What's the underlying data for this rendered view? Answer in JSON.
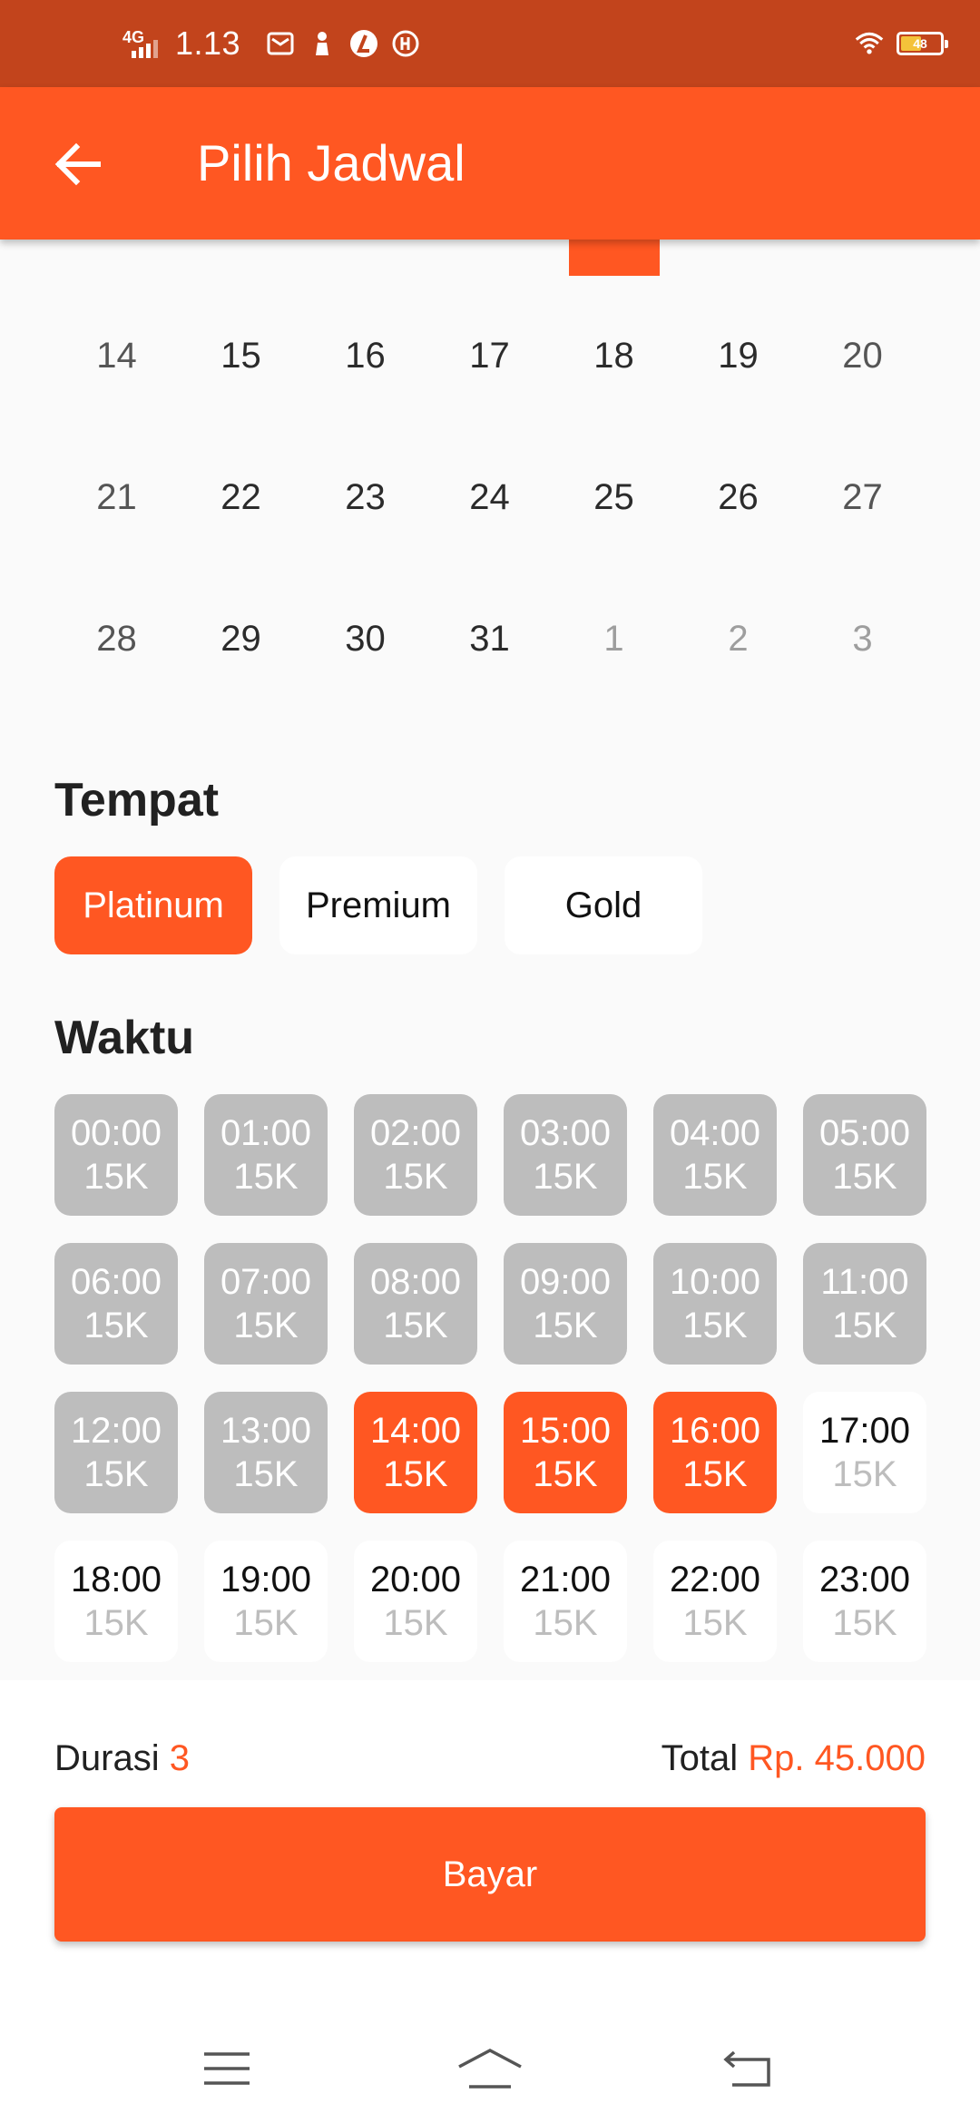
{
  "status_bar": {
    "network": "4G",
    "time": "1.13",
    "battery_level": "48",
    "icons": [
      "mail-icon",
      "person-icon",
      "app-l-icon",
      "app-circle-icon",
      "wifi-icon",
      "battery-icon"
    ]
  },
  "app_bar": {
    "title": "Pilih Jadwal",
    "back_icon": "arrow-left-icon"
  },
  "calendar": {
    "weeks": [
      [
        {
          "day": "14",
          "muted": false
        },
        {
          "day": "15",
          "muted": false
        },
        {
          "day": "16",
          "muted": false
        },
        {
          "day": "17",
          "muted": false
        },
        {
          "day": "18",
          "muted": false
        },
        {
          "day": "19",
          "muted": false
        },
        {
          "day": "20",
          "muted": false
        }
      ],
      [
        {
          "day": "21",
          "muted": false
        },
        {
          "day": "22",
          "muted": false
        },
        {
          "day": "23",
          "muted": false
        },
        {
          "day": "24",
          "muted": false
        },
        {
          "day": "25",
          "muted": false
        },
        {
          "day": "26",
          "muted": false
        },
        {
          "day": "27",
          "muted": false
        }
      ],
      [
        {
          "day": "28",
          "muted": false
        },
        {
          "day": "29",
          "muted": false
        },
        {
          "day": "30",
          "muted": false
        },
        {
          "day": "31",
          "muted": false
        },
        {
          "day": "1",
          "muted": true
        },
        {
          "day": "2",
          "muted": true
        },
        {
          "day": "3",
          "muted": true
        }
      ]
    ]
  },
  "venue": {
    "title": "Tempat",
    "options": [
      {
        "label": "Platinum",
        "selected": true
      },
      {
        "label": "Premium",
        "selected": false
      },
      {
        "label": "Gold",
        "selected": false
      }
    ]
  },
  "time_slots": {
    "title": "Waktu",
    "slots": [
      {
        "time": "00:00",
        "price": "15K",
        "state": "unavailable"
      },
      {
        "time": "01:00",
        "price": "15K",
        "state": "unavailable"
      },
      {
        "time": "02:00",
        "price": "15K",
        "state": "unavailable"
      },
      {
        "time": "03:00",
        "price": "15K",
        "state": "unavailable"
      },
      {
        "time": "04:00",
        "price": "15K",
        "state": "unavailable"
      },
      {
        "time": "05:00",
        "price": "15K",
        "state": "unavailable"
      },
      {
        "time": "06:00",
        "price": "15K",
        "state": "unavailable"
      },
      {
        "time": "07:00",
        "price": "15K",
        "state": "unavailable"
      },
      {
        "time": "08:00",
        "price": "15K",
        "state": "unavailable"
      },
      {
        "time": "09:00",
        "price": "15K",
        "state": "unavailable"
      },
      {
        "time": "10:00",
        "price": "15K",
        "state": "unavailable"
      },
      {
        "time": "11:00",
        "price": "15K",
        "state": "unavailable"
      },
      {
        "time": "12:00",
        "price": "15K",
        "state": "unavailable"
      },
      {
        "time": "13:00",
        "price": "15K",
        "state": "unavailable"
      },
      {
        "time": "14:00",
        "price": "15K",
        "state": "selected"
      },
      {
        "time": "15:00",
        "price": "15K",
        "state": "selected"
      },
      {
        "time": "16:00",
        "price": "15K",
        "state": "selected"
      },
      {
        "time": "17:00",
        "price": "15K",
        "state": "available"
      },
      {
        "time": "18:00",
        "price": "15K",
        "state": "available"
      },
      {
        "time": "19:00",
        "price": "15K",
        "state": "available"
      },
      {
        "time": "20:00",
        "price": "15K",
        "state": "available"
      },
      {
        "time": "21:00",
        "price": "15K",
        "state": "available"
      },
      {
        "time": "22:00",
        "price": "15K",
        "state": "available"
      },
      {
        "time": "23:00",
        "price": "15K",
        "state": "available"
      }
    ]
  },
  "summary": {
    "duration_label": "Durasi",
    "duration_value": "3",
    "total_label": "Total",
    "total_value": "Rp. 45.000"
  },
  "pay_button": {
    "label": "Bayar"
  },
  "nav_bar": {
    "icons": [
      "menu-icon",
      "home-icon",
      "back-icon"
    ]
  },
  "colors": {
    "primary": "#ff5722",
    "status_bar": "#c2441c",
    "unavailable": "#bdbdbd",
    "background": "#fafafa"
  }
}
